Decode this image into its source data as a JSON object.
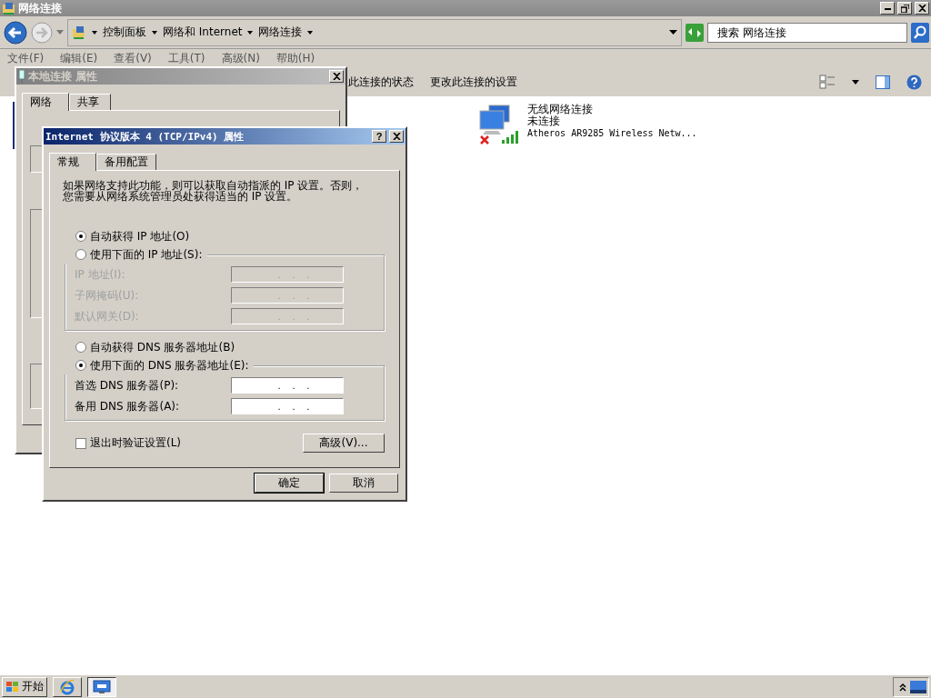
{
  "explorer": {
    "title": "网络连接",
    "breadcrumb": [
      "控制面板",
      "网络和 Internet",
      "网络连接"
    ],
    "search": {
      "placeholder": "搜索 网络连接"
    },
    "menu": [
      "文件(F)",
      "编辑(E)",
      "查看(V)",
      "工具(T)",
      "高级(N)",
      "帮助(H)"
    ],
    "commands": [
      "此连接的状态",
      "更改此连接的设置"
    ],
    "connections": [
      {
        "name": "无线网络连接",
        "status": "未连接",
        "adapter": "Atheros AR9285 Wireless Netw...",
        "connected": false
      }
    ]
  },
  "local_dialog": {
    "title": "本地连接 属性",
    "active": false,
    "tabs": [
      {
        "label": "网络",
        "selected": true
      },
      {
        "label": "共享",
        "selected": false
      }
    ]
  },
  "ipv4_dialog": {
    "title": "Internet 协议版本 4 (TCP/IPv4) 属性",
    "active": true,
    "help": "?",
    "tabs": [
      {
        "label": "常规",
        "selected": true
      },
      {
        "label": "备用配置",
        "selected": false
      }
    ],
    "intro": [
      "如果网络支持此功能，则可以获取自动指派的 IP 设置。否则，",
      "您需要从网络系统管理员处获得适当的 IP 设置。"
    ],
    "sections": [
      {
        "auto": {
          "label": "自动获得 IP 地址(O)",
          "selected": true
        },
        "manual": {
          "label": "使用下面的 IP 地址(S):",
          "selected": false
        },
        "fields": [
          {
            "label": "IP 地址(I):",
            "value": ".    .    .",
            "disabled": true
          },
          {
            "label": "子网掩码(U):",
            "value": ".    .    .",
            "disabled": true
          },
          {
            "label": "默认网关(D):",
            "value": ".    .    .",
            "disabled": true
          }
        ]
      },
      {
        "auto": {
          "label": "自动获得 DNS 服务器地址(B)",
          "selected": false
        },
        "manual": {
          "label": "使用下面的 DNS 服务器地址(E):",
          "selected": true
        },
        "fields": [
          {
            "label": "首选 DNS 服务器(P):",
            "value": ".    .    .",
            "disabled": false
          },
          {
            "label": "备用 DNS 服务器(A):",
            "value": ".    .    .",
            "disabled": false
          }
        ]
      }
    ],
    "validate": {
      "label": "退出时验证设置(L)",
      "checked": false
    },
    "advanced": "高级(V)...",
    "buttons": [
      {
        "label": "确定",
        "default": true
      },
      {
        "label": "取消",
        "default": false
      }
    ]
  },
  "taskbar": {
    "start": "开始",
    "apps": [
      {
        "kind": "browser",
        "selected": false
      },
      {
        "kind": "network",
        "selected": true
      }
    ]
  }
}
